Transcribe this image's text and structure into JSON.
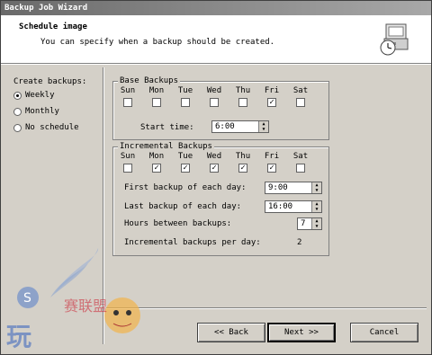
{
  "window": {
    "title": "Backup Job Wizard"
  },
  "header": {
    "title": "Schedule image",
    "subtitle": "You can specify when a backup should be created."
  },
  "schedule": {
    "label": "Create backups:",
    "options": [
      {
        "label": "Weekly",
        "selected": true
      },
      {
        "label": "Monthly",
        "selected": false
      },
      {
        "label": "No schedule",
        "selected": false
      }
    ]
  },
  "base": {
    "title": "Base Backups",
    "days": [
      "Sun",
      "Mon",
      "Tue",
      "Wed",
      "Thu",
      "Fri",
      "Sat"
    ],
    "checked": [
      false,
      false,
      false,
      false,
      false,
      true,
      false
    ],
    "start_time_label": "Start time:",
    "start_time": "6:00"
  },
  "incremental": {
    "title": "Incremental Backups",
    "days": [
      "Sun",
      "Mon",
      "Tue",
      "Wed",
      "Thu",
      "Fri",
      "Sat"
    ],
    "checked": [
      false,
      true,
      true,
      true,
      true,
      true,
      false
    ],
    "first_label": "First backup of each day:",
    "first_value": "9:00",
    "last_label": "Last backup of each day:",
    "last_value": "16:00",
    "hours_label": "Hours between backups:",
    "hours_value": "7",
    "perday_label": "Incremental backups per day:",
    "perday_value": "2"
  },
  "buttons": {
    "back": "<< Back",
    "next": "Next >>",
    "cancel": "Cancel"
  },
  "check_mark": "✓",
  "watermark": {
    "text": "赛联盟"
  }
}
